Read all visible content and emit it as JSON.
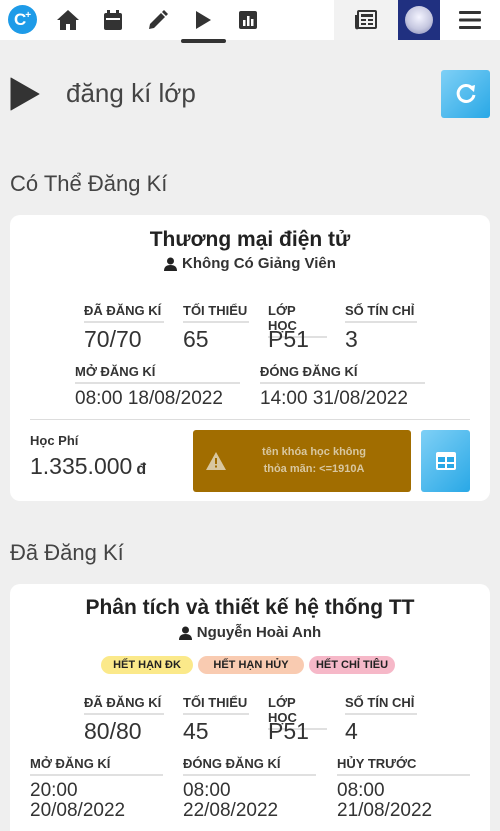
{
  "nav": {
    "logo_letter": "C",
    "logo_sup": "+",
    "items": [
      "home-icon",
      "calendar-icon",
      "pencil-icon",
      "play-icon",
      "chart-icon"
    ],
    "right": [
      "news-icon",
      "avatar",
      "menu-icon"
    ]
  },
  "page": {
    "title": "đăng kí lớp"
  },
  "available": {
    "section_title": "Có Thể Đăng Kí",
    "course": {
      "name": "Thương mại điện tử",
      "teacher": "Không Có Giảng Viên",
      "registered_label": "ĐÃ ĐĂNG KÍ",
      "registered": "70/70",
      "min_label": "TỐI THIỂU",
      "min": "65",
      "class_label": "LỚP HỌC",
      "class": "P51",
      "credits_label": "SỐ TÍN CHỈ",
      "credits": "3",
      "open_label": "MỞ ĐĂNG KÍ",
      "open": "08:00 18/08/2022",
      "close_label": "ĐÓNG ĐĂNG KÍ",
      "close": "14:00 31/08/2022",
      "fee_label": "Học Phí",
      "fee": "1.335.000",
      "currency": "đ",
      "warning_line1": "tên khóa học không",
      "warning_line2": "thỏa mãn: <=1910A"
    }
  },
  "registered": {
    "section_title": "Đã Đăng Kí",
    "course": {
      "name": "Phân tích và thiết kế hệ thống TT",
      "teacher": "Nguyễn Hoài Anh",
      "badges": [
        {
          "label": "HẾT HẠN ĐK",
          "color": "#fbe98a"
        },
        {
          "label": "HẾT HẠN HỦY",
          "color": "#f9cbb1"
        },
        {
          "label": "HẾT CHỈ TIÊU",
          "color": "#f6b8c8"
        }
      ],
      "registered_label": "ĐÃ ĐĂNG KÍ",
      "registered": "80/80",
      "min_label": "TỐI THIỂU",
      "min": "45",
      "class_label": "LỚP HỌC",
      "class": "P51",
      "credits_label": "SỐ TÍN CHỈ",
      "credits": "4",
      "open_label": "MỞ ĐĂNG KÍ",
      "open_time": "20:00",
      "open_date": "20/08/2022",
      "close_label": "ĐÓNG ĐĂNG KÍ",
      "close_time": "08:00",
      "close_date": "22/08/2022",
      "cancel_label": "HỦY TRƯỚC",
      "cancel_time": "08:00",
      "cancel_date": "21/08/2022"
    }
  },
  "colors": {
    "accent": "#29a8e6",
    "warning": "#a16d00",
    "logo": "#1e9be8"
  }
}
